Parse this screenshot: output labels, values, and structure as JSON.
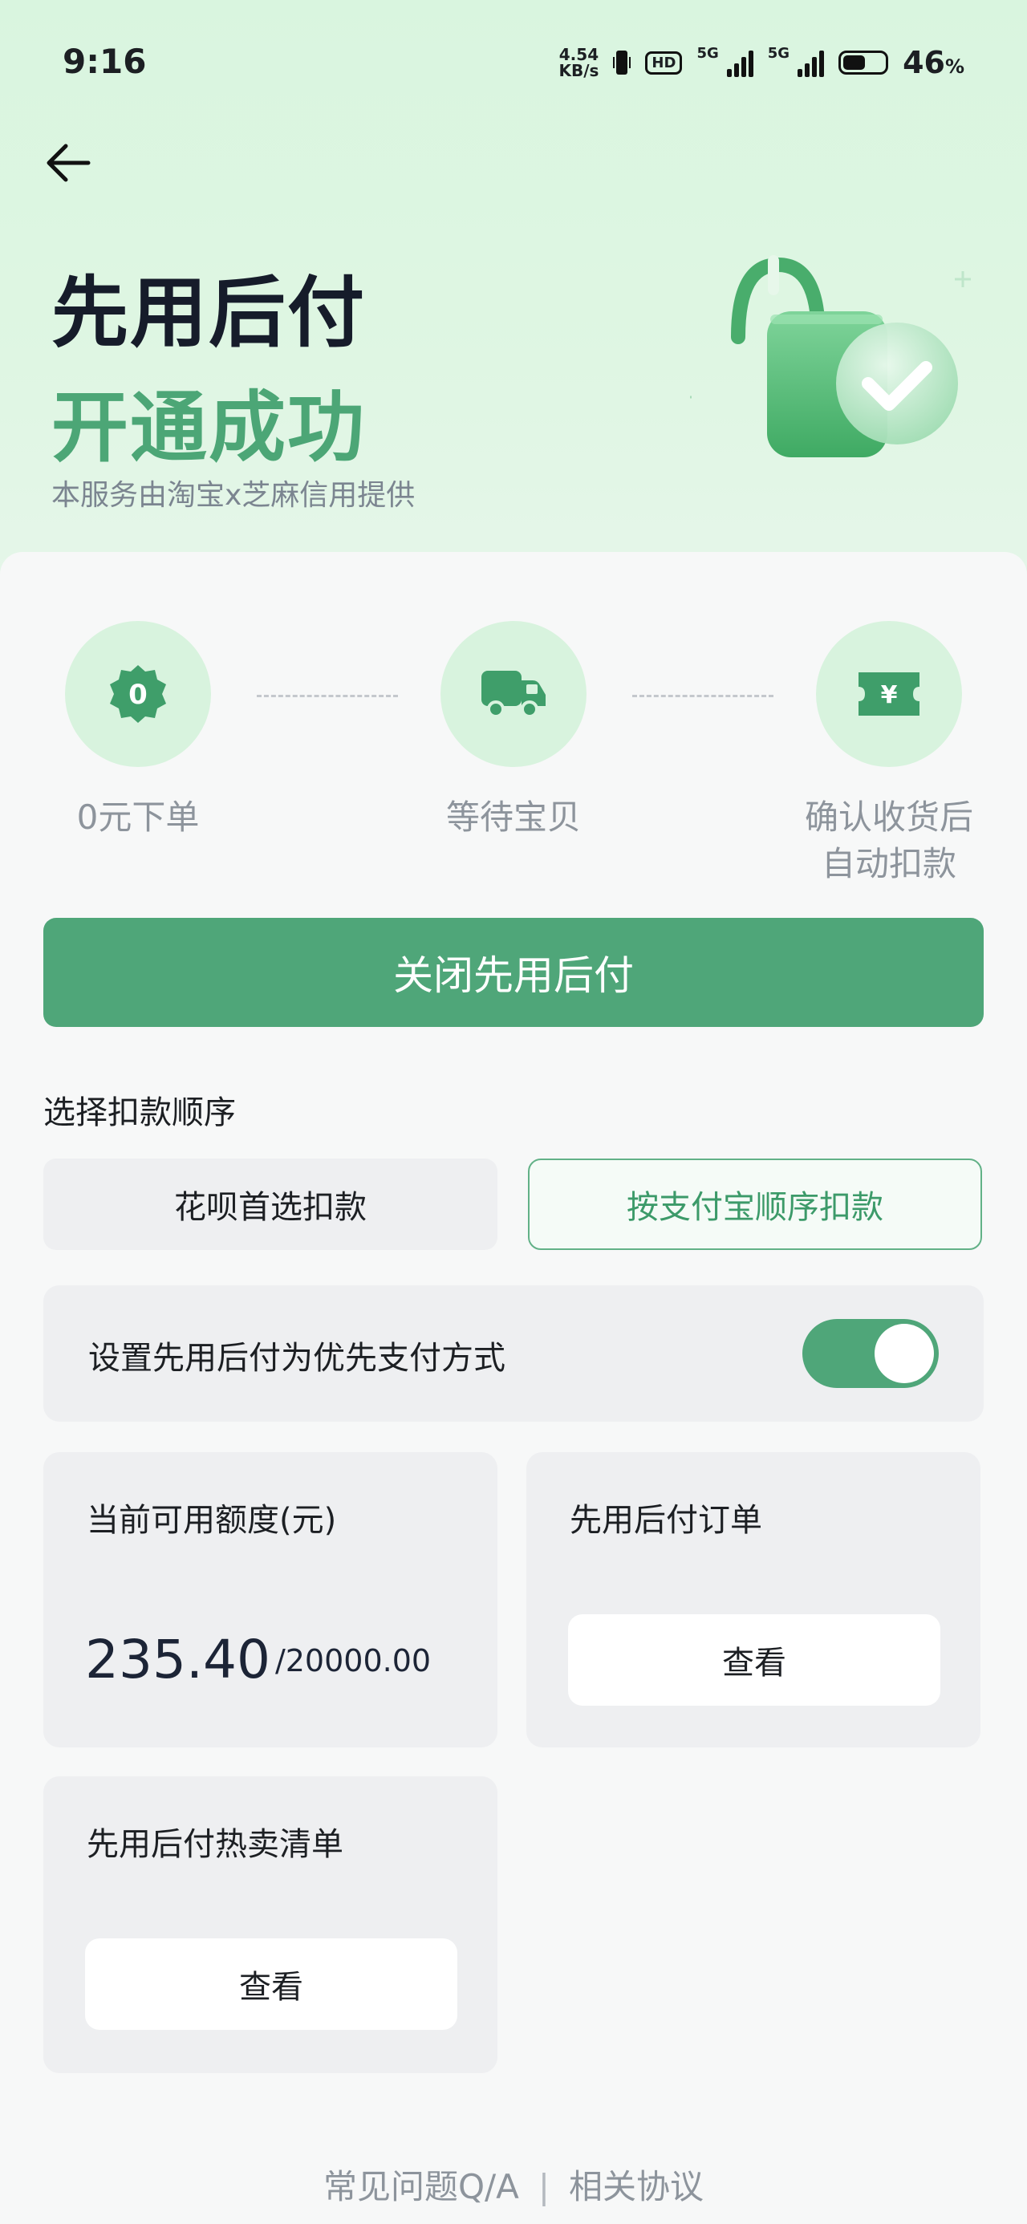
{
  "status_bar": {
    "time": "9:16",
    "net_speed_value": "4.54",
    "net_speed_unit": "KB/s",
    "hd_label": "HD",
    "network1": "5G",
    "network2": "5G",
    "battery_value": "46",
    "battery_unit": "%"
  },
  "header": {
    "title_line1": "先用后付",
    "title_line2": "开通成功",
    "provider": "本服务由淘宝x芝麻信用提供"
  },
  "steps": [
    {
      "icon_text": "0",
      "label": "0元下单",
      "icon": "zero-badge-icon"
    },
    {
      "label": "等待宝贝",
      "icon": "truck-icon"
    },
    {
      "icon_text": "¥",
      "label_line1": "确认收货后",
      "label_line2": "自动扣款",
      "icon": "yuan-ticket-icon"
    }
  ],
  "close_button": "关闭先用后付",
  "deduction": {
    "label": "选择扣款顺序",
    "option_huabei": "花呗首选扣款",
    "option_alipay": "按支付宝顺序扣款",
    "selected": "按支付宝顺序扣款"
  },
  "preference": {
    "label": "设置先用后付为优先支付方式",
    "enabled": true
  },
  "quota": {
    "title": "当前可用额度(元)",
    "available": "235.40",
    "total": "/20000.00"
  },
  "orders": {
    "title": "先用后付订单",
    "button": "查看"
  },
  "hot_list": {
    "title": "先用后付热卖清单",
    "button": "查看"
  },
  "footer": {
    "faq": "常见问题Q/A",
    "separator": "|",
    "agreement": "相关协议"
  },
  "colors": {
    "accent": "#4fa679",
    "header_bg": "#d9f5df",
    "title_green": "#4ca676"
  }
}
